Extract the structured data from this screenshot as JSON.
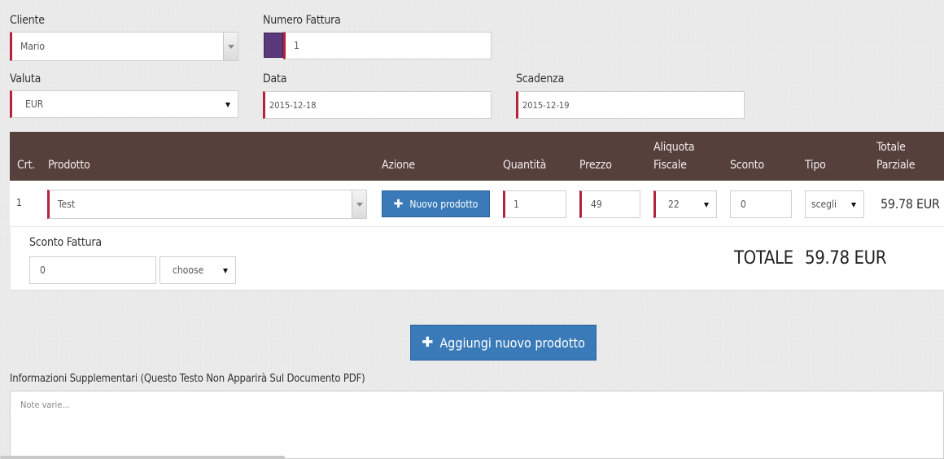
{
  "form": {
    "cliente": {
      "label": "Cliente",
      "value": "Mario"
    },
    "numero_fattura": {
      "label": "Numero Fattura",
      "value": "1",
      "color_swatch": "#5a3a7a"
    },
    "valuta": {
      "label": "Valuta",
      "value": "EUR"
    },
    "data": {
      "label": "Data",
      "value": "2015-12-18"
    },
    "scadenza": {
      "label": "Scadenza",
      "value": "2015-12-19"
    }
  },
  "table": {
    "headers": {
      "crt": "Crt.",
      "prodotto": "Prodotto",
      "azione": "Azione",
      "quantita": "Quantità",
      "prezzo": "Prezzo",
      "aliquota_1": "Aliquota",
      "aliquota_2": "Fiscale",
      "sconto": "Sconto",
      "tipo": "Tipo",
      "totale_1": "Totale",
      "totale_2": "Parziale"
    },
    "rows": [
      {
        "crt": "1",
        "prodotto": "Test",
        "azione_label": "Nuovo prodotto",
        "quantita": "1",
        "prezzo": "49",
        "aliquota": "22",
        "sconto": "0",
        "tipo": "scegli",
        "totale": "59.78 EUR"
      }
    ]
  },
  "summary": {
    "sconto_fattura_label": "Sconto Fattura",
    "sconto_fattura_value": "0",
    "sconto_tipo": "choose",
    "totale_label": "TOTALE",
    "totale_value": "59.78 EUR"
  },
  "add_button_label": "Aggiungi nuovo prodotto",
  "notes": {
    "label": "Informazioni Supplementari (Questo Testo Non Apparirà Sul Documento PDF)",
    "placeholder": "Note varie..."
  },
  "colors": {
    "header_bg": "#55403c",
    "accent_red": "#b5233b",
    "button_blue": "#3a7ab8"
  }
}
